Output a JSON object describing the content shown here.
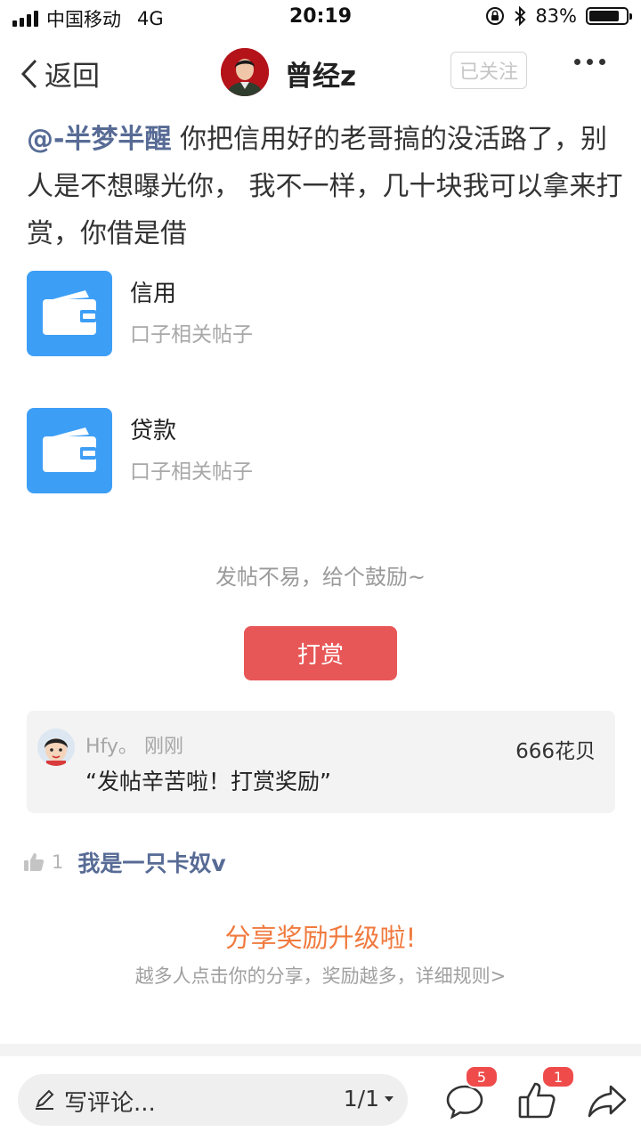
{
  "status_bar": {
    "carrier": "中国移动",
    "network": "4G",
    "time": "20:19",
    "battery": "83%",
    "battery_level": 0.83
  },
  "nav": {
    "back_label": "返回",
    "author": "曾经z",
    "follow_label": "已关注"
  },
  "post": {
    "mention": "@-半梦半醒",
    "text": " 你把信用好的老哥搞的没活路了，别人是不想曝光你， 我不一样，几十块我可以拿来打赏，你借是借"
  },
  "topics": [
    {
      "title": "信用",
      "subtitle": "口子相关帖子"
    },
    {
      "title": "贷款",
      "subtitle": "口子相关帖子"
    }
  ],
  "tip": {
    "prompt": "发帖不易，给个鼓励~",
    "button_label": "打赏"
  },
  "reward": {
    "user": "Hfy。",
    "time": "刚刚",
    "amount": "666花贝",
    "message": "“发帖辛苦啦！打赏奖励”"
  },
  "likes": {
    "count": "1",
    "user": "我是一只卡奴v"
  },
  "share": {
    "title": "分享奖励升级啦!",
    "subtitle": "越多人点击你的分享，奖励越多，详细规则>"
  },
  "bottom_bar": {
    "comment_placeholder": "写评论...",
    "page": "1/1",
    "comment_badge": "5",
    "like_badge": "1"
  },
  "colors": {
    "accent_red": "#e85757",
    "link_blue": "#576b95",
    "topic_blue": "#3d9ef6",
    "share_orange": "#f07a3e",
    "badge_red": "#ef4b4b"
  }
}
